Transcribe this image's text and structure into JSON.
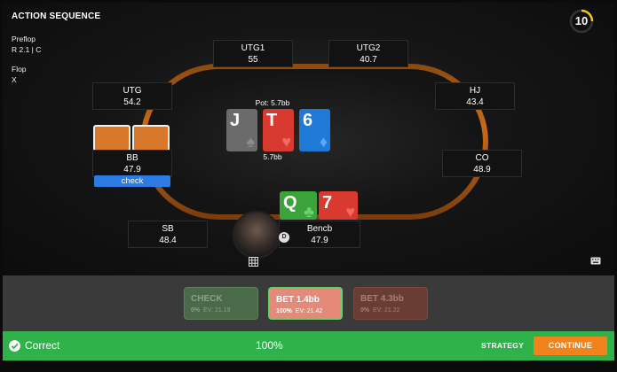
{
  "header": {
    "title": "ACTION SEQUENCE",
    "timer": "10",
    "timer_icon": "circular-timer-icon"
  },
  "sequence": [
    {
      "street": "Preflop",
      "actions": "R 2.1  |  C"
    },
    {
      "street": "Flop",
      "actions": "X"
    }
  ],
  "seats": {
    "utg1": {
      "name": "UTG1",
      "stack": "55"
    },
    "utg2": {
      "name": "UTG2",
      "stack": "40.7"
    },
    "utg": {
      "name": "UTG",
      "stack": "54.2"
    },
    "hj": {
      "name": "HJ",
      "stack": "43.4"
    },
    "bb": {
      "name": "BB",
      "stack": "47.9",
      "action": "check"
    },
    "co": {
      "name": "CO",
      "stack": "48.9"
    },
    "sb": {
      "name": "SB",
      "stack": "48.4"
    },
    "hero": {
      "name": "Bencb",
      "stack": "47.9"
    }
  },
  "pot": {
    "label": "Pot: 5.7bb",
    "amount": "5.7bb"
  },
  "board": [
    {
      "rank": "J",
      "suit": "♠",
      "color": "#6b6b6b"
    },
    {
      "rank": "T",
      "suit": "♥",
      "color": "#d83a2f"
    },
    {
      "rank": "6",
      "suit": "♦",
      "color": "#1f7ad6"
    }
  ],
  "hero_cards": [
    {
      "rank": "Q",
      "suit": "♣",
      "color": "#3aa33a"
    },
    {
      "rank": "7",
      "suit": "♥",
      "color": "#d83a2f"
    }
  ],
  "actions": [
    {
      "label": "CHECK",
      "freq": "0%",
      "ev": "EV: 21.19",
      "bg": "#4a6a4a",
      "border": "#5e7e5e",
      "text": "#8aa08a"
    },
    {
      "label": "BET 1.4bb",
      "freq": "100%",
      "ev": "EV: 21.42",
      "bg": "#e58a78",
      "border": "#5fd16a",
      "text": "#ffffff"
    },
    {
      "label": "BET 4.3bb",
      "freq": "0%",
      "ev": "EV: 21.22",
      "bg": "#6a3d34",
      "border": "#7a4a40",
      "text": "#a08078"
    }
  ],
  "status": {
    "label": "Correct",
    "percent": "100%",
    "strategy": "STRATEGY",
    "continue": "CONTINUE",
    "color": "#2fb24a",
    "accent": "#f2821b"
  }
}
